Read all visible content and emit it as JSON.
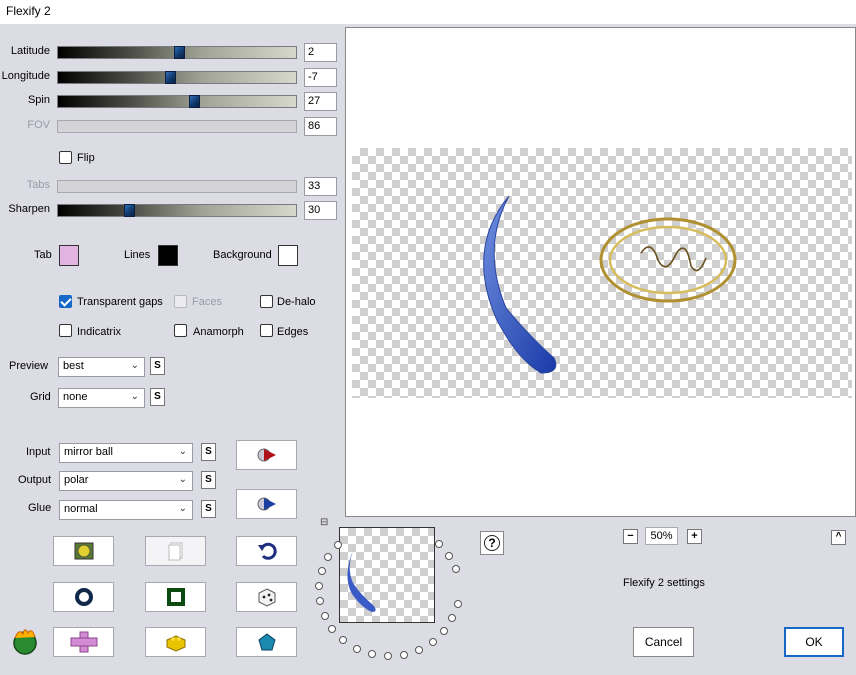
{
  "window": {
    "title": "Flexify 2"
  },
  "sliders": [
    {
      "label": "Latitude",
      "value": "2",
      "disabled": false,
      "thumb": 0.51
    },
    {
      "label": "Longitude",
      "value": "-7",
      "disabled": false,
      "thumb": 0.47
    },
    {
      "label": "Spin",
      "value": "27",
      "disabled": false,
      "thumb": 0.57
    },
    {
      "label": "FOV",
      "value": "86",
      "disabled": true
    },
    {
      "label": "Tabs",
      "value": "33",
      "disabled": true
    },
    {
      "label": "Sharpen",
      "value": "30",
      "disabled": false,
      "thumb": 0.3
    }
  ],
  "flip": {
    "label": "Flip",
    "checked": false
  },
  "colors": {
    "tab": {
      "label": "Tab",
      "color": "#e2b4e2"
    },
    "lines": {
      "label": "Lines",
      "color": "#000000"
    },
    "background": {
      "label": "Background",
      "color": "#ffffff"
    }
  },
  "options": {
    "transparent_gaps": {
      "label": "Transparent gaps",
      "checked": true
    },
    "faces": {
      "label": "Faces",
      "checked": false,
      "disabled": true
    },
    "de_halo": {
      "label": "De-halo",
      "checked": false
    },
    "indicatrix": {
      "label": "Indicatrix",
      "checked": false
    },
    "anamorph": {
      "label": "Anamorph",
      "checked": false
    },
    "edges": {
      "label": "Edges",
      "checked": false
    }
  },
  "selects": {
    "preview": {
      "label": "Preview",
      "value": "best"
    },
    "grid": {
      "label": "Grid",
      "value": "none"
    },
    "input": {
      "label": "Input",
      "value": "mirror ball"
    },
    "output": {
      "label": "Output",
      "value": "polar"
    },
    "glue": {
      "label": "Glue",
      "value": "normal"
    }
  },
  "s_label": "S",
  "zoom": {
    "value": "50%",
    "minus": "−",
    "plus": "+"
  },
  "help_label": "?",
  "expand_label": "^",
  "settings_label": "Flexify 2 settings",
  "buttons": {
    "cancel": "Cancel",
    "ok": "OK"
  },
  "accent": "#1668c6"
}
